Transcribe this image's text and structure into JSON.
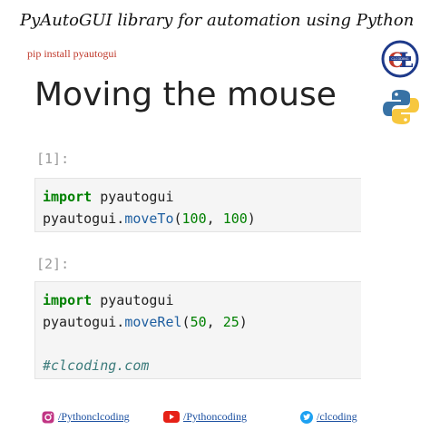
{
  "header": {
    "title": "PyAutoGUI library for automation using Python",
    "subtitle": "pip install pyautogui"
  },
  "notebook": {
    "heading": "Moving the mouse",
    "cells": [
      {
        "prompt": "[1]:",
        "lines": [
          [
            "import",
            "pyautogui"
          ],
          [
            "pyautogui.",
            "moveTo",
            "(",
            "100",
            ", ",
            "100",
            ")"
          ]
        ]
      },
      {
        "prompt": "[2]:",
        "lines": [
          [
            "import",
            "pyautogui"
          ],
          [
            "pyautogui.",
            "moveRel",
            "(",
            "50",
            ", ",
            "25",
            ")"
          ],
          [
            ""
          ],
          [
            "#clcoding.com"
          ]
        ]
      }
    ]
  },
  "logos": {
    "cl_logo_text": "CL",
    "cl_logo_small": "CLCODING",
    "python_logo": "python-logo-icon"
  },
  "footer": {
    "instagram": "/Pythonclcoding",
    "youtube": "/Pythoncoding",
    "twitter": "/clcoding"
  },
  "colors": {
    "keyword": "#008000",
    "function": "#1f5fa0",
    "comment": "#3b7b7b",
    "subtitle": "#c0392b",
    "link": "#1a4fa0"
  }
}
